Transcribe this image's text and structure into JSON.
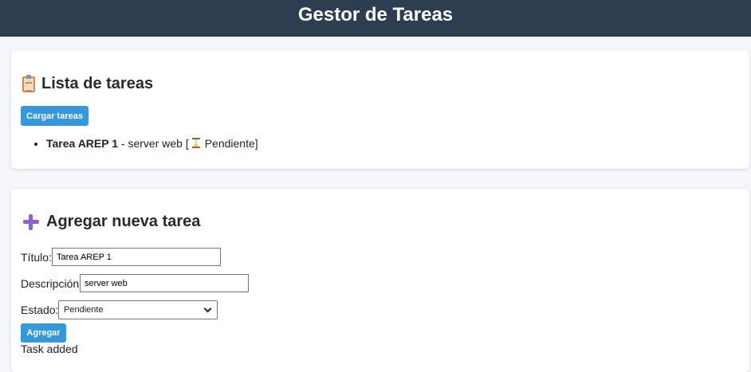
{
  "header": {
    "title": "Gestor de Tareas"
  },
  "task_list_section": {
    "icon": "clipboard-icon",
    "title": "Lista de tareas",
    "load_button": "Cargar tareas",
    "tasks": [
      {
        "title": "Tarea AREP 1",
        "separator": " - ",
        "description": "server web",
        "open": " [",
        "status_icon": "hourglass-icon",
        "status": "Pendiente",
        "close": "]"
      }
    ]
  },
  "add_section": {
    "icon": "plus-icon",
    "title": "Agregar nueva tarea",
    "title_label": "Título:",
    "title_value": "Tarea AREP 1",
    "description_label": "Descripción:",
    "description_value": "server web",
    "state_label": "Estado:",
    "state_value": "Pendiente",
    "add_button": "Agregar",
    "message": "Task added"
  },
  "colors": {
    "header_bg": "#2c3e50",
    "button": "#3498db",
    "page_bg": "#f4f6f9"
  }
}
